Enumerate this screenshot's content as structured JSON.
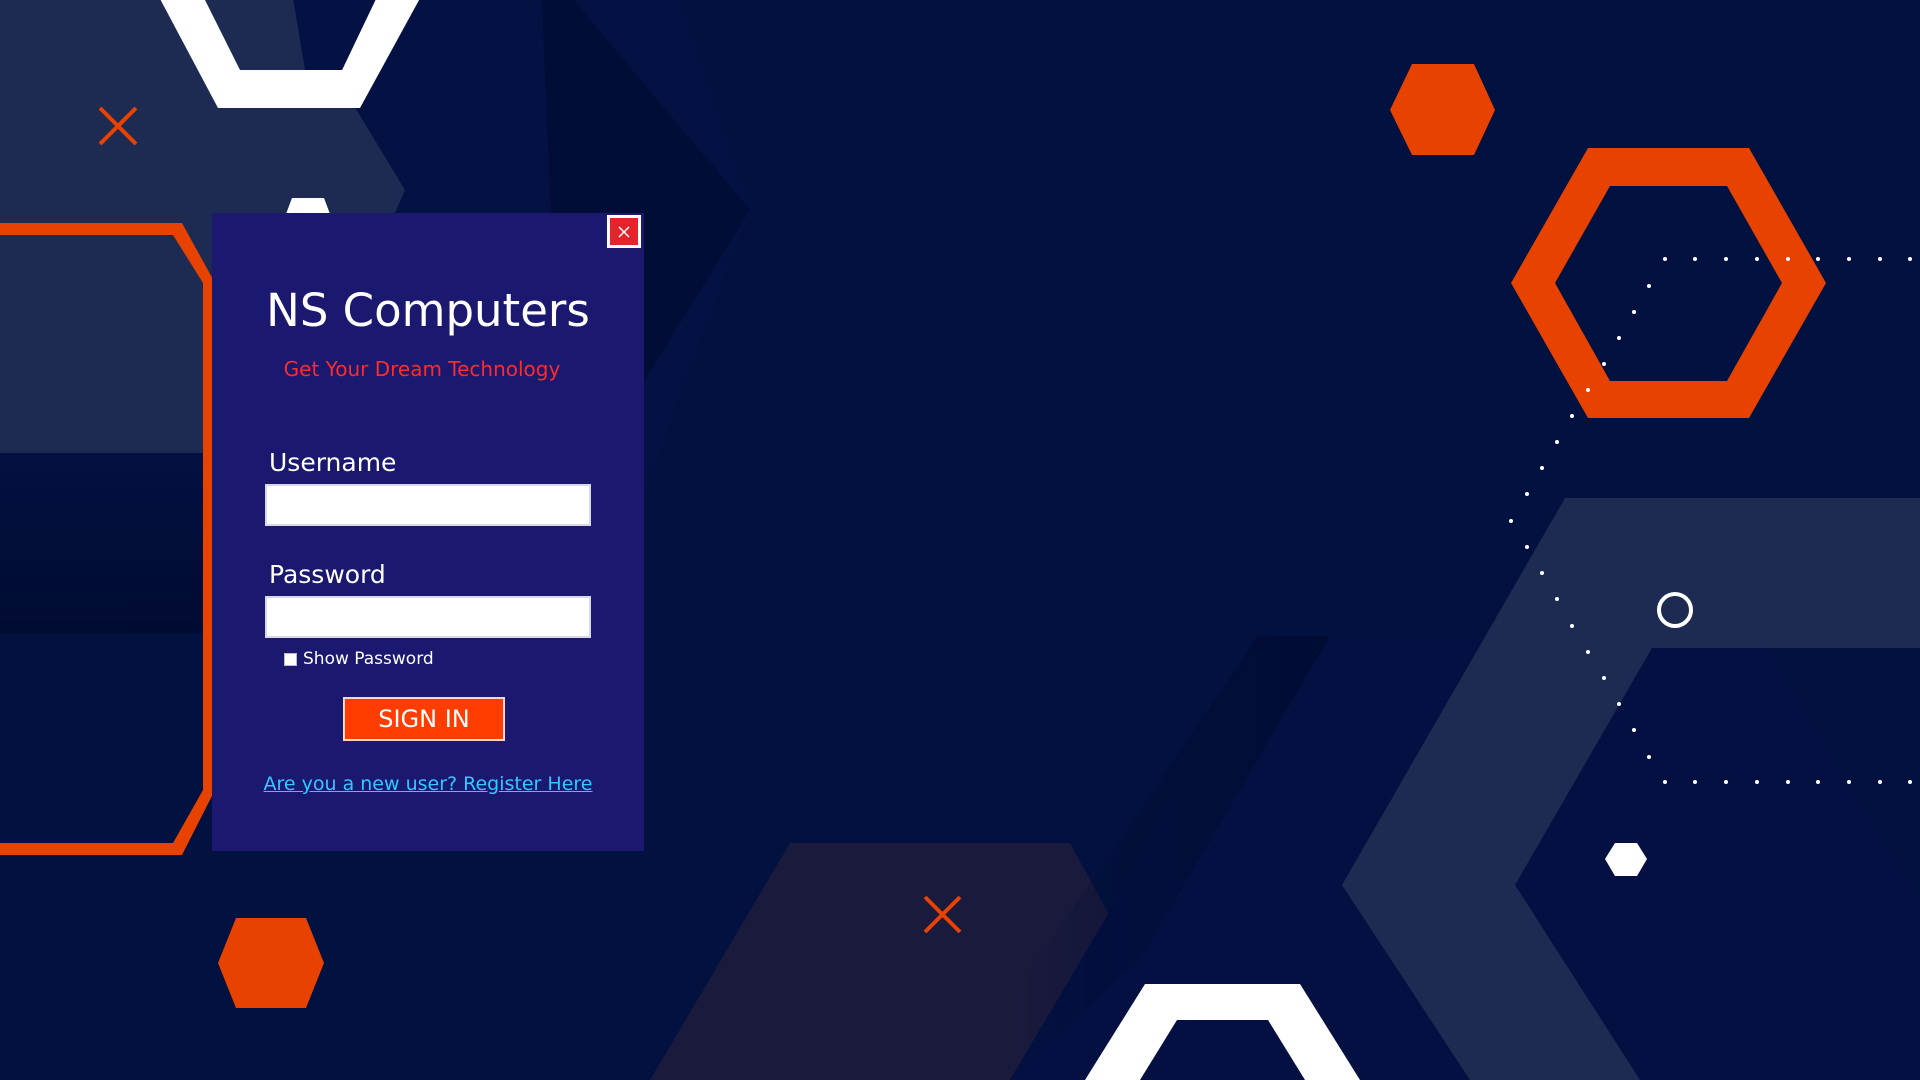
{
  "login": {
    "title": "NS Computers",
    "subtitle": "Get Your Dream Technology",
    "username_label": "Username",
    "username_value": "",
    "password_label": "Password",
    "password_value": "",
    "show_password_label": "Show Password",
    "show_password_checked": false,
    "signin_label": "SIGN IN",
    "register_link": "Are you a new user? Register Here"
  },
  "colors": {
    "background": "#02113f",
    "panel": "#1b1870",
    "accent_orange": "#e84200",
    "subtitle_red": "#ff2a2a",
    "link_cyan": "#33c8ff",
    "close_red": "#e3242b"
  },
  "icons": {
    "close": "close-icon",
    "decor": [
      "hexagon-shape",
      "cross-mark",
      "ring-shape",
      "dot-trail"
    ]
  }
}
